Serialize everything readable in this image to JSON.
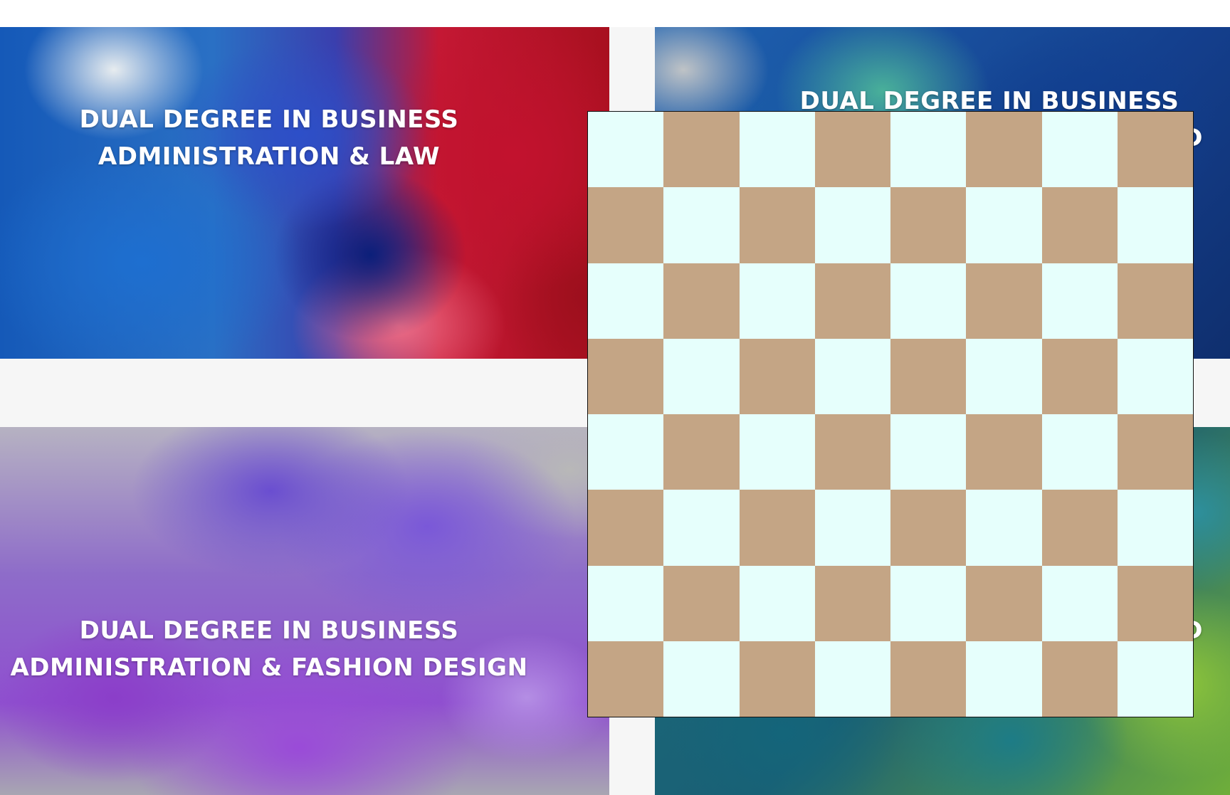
{
  "cards": [
    {
      "lines": [
        "Dual Degree in Business",
        "Administration & Law"
      ]
    },
    {
      "lines": [
        "Dual Degree in Business",
        "D"
      ]
    },
    {
      "lines": [
        "Dual Degree in Business",
        "Administration & Fashion Design"
      ]
    },
    {
      "lines": [
        "",
        "ND"
      ]
    }
  ],
  "board": {
    "rows": 8,
    "cols": 8,
    "light_color": "#e6fffc",
    "dark_color": "#c4a585",
    "border_color": "#111111"
  }
}
